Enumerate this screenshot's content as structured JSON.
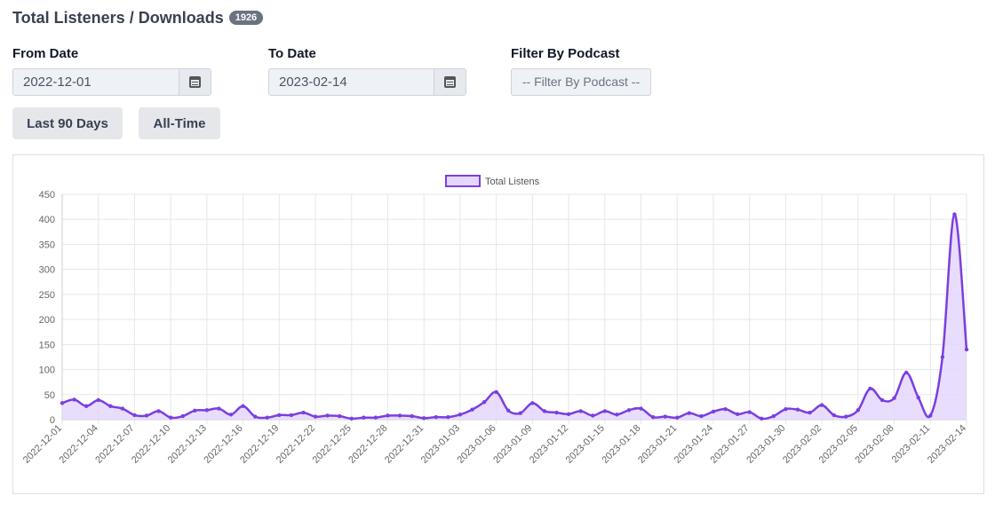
{
  "header": {
    "title": "Total Listeners / Downloads",
    "count_badge": "1926"
  },
  "filters": {
    "from_label": "From Date",
    "from_value": "2022-12-01",
    "to_label": "To Date",
    "to_value": "2023-02-14",
    "podcast_label": "Filter By Podcast",
    "podcast_selected": "-- Filter By Podcast --"
  },
  "buttons": {
    "last90": "Last 90 Days",
    "alltime": "All-Time"
  },
  "icons": {
    "date_picker": "calendar-icon"
  },
  "colors": {
    "line": "#7a3fe0",
    "fill": "#e4d7fb",
    "grid": "#e5e7eb"
  },
  "chart_data": {
    "type": "area",
    "legend": {
      "label": "Total Listens",
      "position": "top"
    },
    "ylim": [
      0,
      450
    ],
    "yticks": [
      0,
      50,
      100,
      150,
      200,
      250,
      300,
      350,
      400,
      450
    ],
    "grid": true,
    "x_tick_labels": [
      "2022-12-01",
      "2022-12-04",
      "2022-12-07",
      "2022-12-10",
      "2022-12-13",
      "2022-12-16",
      "2022-12-19",
      "2022-12-22",
      "2022-12-25",
      "2022-12-28",
      "2022-12-31",
      "2023-01-03",
      "2023-01-06",
      "2023-01-09",
      "2023-01-12",
      "2023-01-15",
      "2023-01-18",
      "2023-01-21",
      "2023-01-24",
      "2023-01-27",
      "2023-01-30",
      "2023-02-02",
      "2023-02-05",
      "2023-02-08",
      "2023-02-11",
      "2023-02-14"
    ],
    "series": [
      {
        "name": "Total Listens",
        "x": [
          "2022-12-01",
          "2022-12-02",
          "2022-12-03",
          "2022-12-04",
          "2022-12-05",
          "2022-12-06",
          "2022-12-07",
          "2022-12-08",
          "2022-12-09",
          "2022-12-10",
          "2022-12-11",
          "2022-12-12",
          "2022-12-13",
          "2022-12-14",
          "2022-12-15",
          "2022-12-16",
          "2022-12-17",
          "2022-12-18",
          "2022-12-19",
          "2022-12-20",
          "2022-12-21",
          "2022-12-22",
          "2022-12-23",
          "2022-12-24",
          "2022-12-25",
          "2022-12-26",
          "2022-12-27",
          "2022-12-28",
          "2022-12-29",
          "2022-12-30",
          "2022-12-31",
          "2023-01-01",
          "2023-01-02",
          "2023-01-03",
          "2023-01-04",
          "2023-01-05",
          "2023-01-06",
          "2023-01-07",
          "2023-01-08",
          "2023-01-09",
          "2023-01-10",
          "2023-01-11",
          "2023-01-12",
          "2023-01-13",
          "2023-01-14",
          "2023-01-15",
          "2023-01-16",
          "2023-01-17",
          "2023-01-18",
          "2023-01-19",
          "2023-01-20",
          "2023-01-21",
          "2023-01-22",
          "2023-01-23",
          "2023-01-24",
          "2023-01-25",
          "2023-01-26",
          "2023-01-27",
          "2023-01-28",
          "2023-01-29",
          "2023-01-30",
          "2023-01-31",
          "2023-02-01",
          "2023-02-02",
          "2023-02-03",
          "2023-02-04",
          "2023-02-05",
          "2023-02-06",
          "2023-02-07",
          "2023-02-08",
          "2023-02-09",
          "2023-02-10",
          "2023-02-11",
          "2023-02-12",
          "2023-02-13",
          "2023-02-14"
        ],
        "values": [
          33,
          40,
          27,
          39,
          27,
          22,
          9,
          8,
          17,
          4,
          7,
          18,
          19,
          22,
          10,
          27,
          6,
          4,
          9,
          9,
          14,
          6,
          8,
          7,
          2,
          4,
          4,
          8,
          8,
          7,
          3,
          5,
          5,
          10,
          20,
          35,
          55,
          18,
          13,
          33,
          17,
          14,
          11,
          17,
          8,
          17,
          10,
          19,
          22,
          5,
          6,
          4,
          13,
          7,
          16,
          21,
          11,
          15,
          2,
          7,
          21,
          20,
          14,
          29,
          9,
          6,
          19,
          62,
          39,
          43,
          94,
          44,
          8,
          125,
          410,
          140
        ]
      }
    ]
  }
}
